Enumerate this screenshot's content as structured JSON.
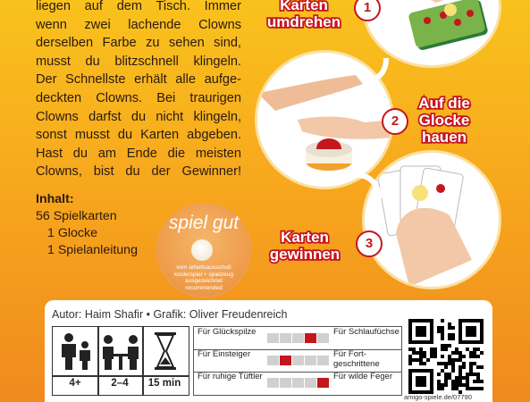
{
  "rules_text": [
    "liegen auf dem Tisch. Immer",
    "wenn zwei lachende Clowns",
    "derselben Farbe zu sehen sind,",
    "musst du blitzschnell klingeln.",
    "Der Schnellste erhält alle aufge-",
    "deckten Clowns. Bei traurigen",
    "Clowns darfst du nicht klingeln,",
    "sonst musst du Karten abgeben.",
    "Hast du am Ende die meisten",
    "Clowns, bist du der Gewinner!"
  ],
  "contents": {
    "title": "Inhalt:",
    "items": [
      "56 Spielkarten",
      "1 Glocke",
      "1 Spielanleitung"
    ]
  },
  "badge": {
    "title": "spiel gut",
    "lines": [
      "vom arbeitsausschuß",
      "kinderspiel + spielzeug",
      "ausgezeichnet",
      "recommended"
    ]
  },
  "steps": [
    {
      "number": "1",
      "label_lines": [
        "Karten",
        "umdrehen"
      ]
    },
    {
      "number": "2",
      "label_lines": [
        "Auf die",
        "Glocke",
        "hauen"
      ]
    },
    {
      "number": "3",
      "label_lines": [
        "Karten",
        "gewinnen"
      ]
    }
  ],
  "credits": "Autor: Haim Shafir • Grafik: Oliver Freudenreich",
  "specs": {
    "age": "4+",
    "players": "2–4",
    "time": "15 min"
  },
  "rating_rows": [
    {
      "left": "Für Glückspilze",
      "right": "Für Schlaufüchse",
      "level": 3
    },
    {
      "left": "Für Einsteiger",
      "right": "Für Fort-geschrittene",
      "level": 1
    },
    {
      "left": "Für ruhige Tüftler",
      "right": "Für wilde Feger",
      "level": 4
    }
  ],
  "qr_url": "amigo-spiele.de/07790",
  "colors": {
    "accent_red": "#c5161e",
    "bg_top": "#f9c21d",
    "bg_bottom": "#f08a1e"
  }
}
